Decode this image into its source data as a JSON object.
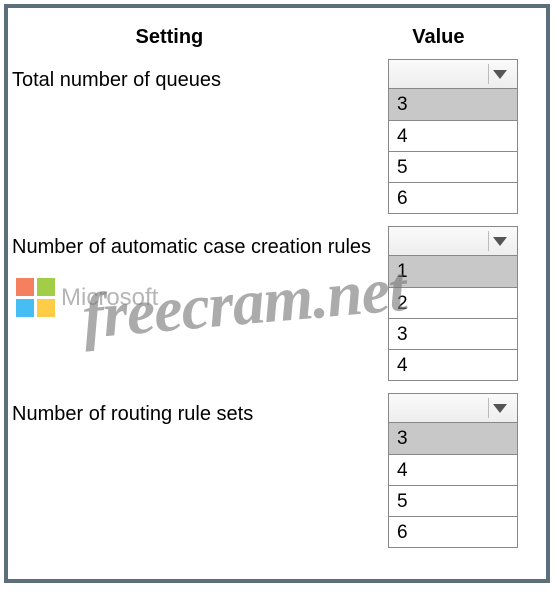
{
  "headers": {
    "setting": "Setting",
    "value": "Value"
  },
  "rows": [
    {
      "label": "Total number of queues",
      "options": [
        "3",
        "4",
        "5",
        "6"
      ],
      "highlighted_index": 0
    },
    {
      "label": "Number of automatic case creation rules",
      "options": [
        "1",
        "2",
        "3",
        "4"
      ],
      "highlighted_index": 0
    },
    {
      "label": "Number of routing rule sets",
      "options": [
        "3",
        "4",
        "5",
        "6"
      ],
      "highlighted_index": 0
    }
  ],
  "watermark": {
    "microsoft": "Microsoft",
    "freecram": "freecram.net"
  }
}
